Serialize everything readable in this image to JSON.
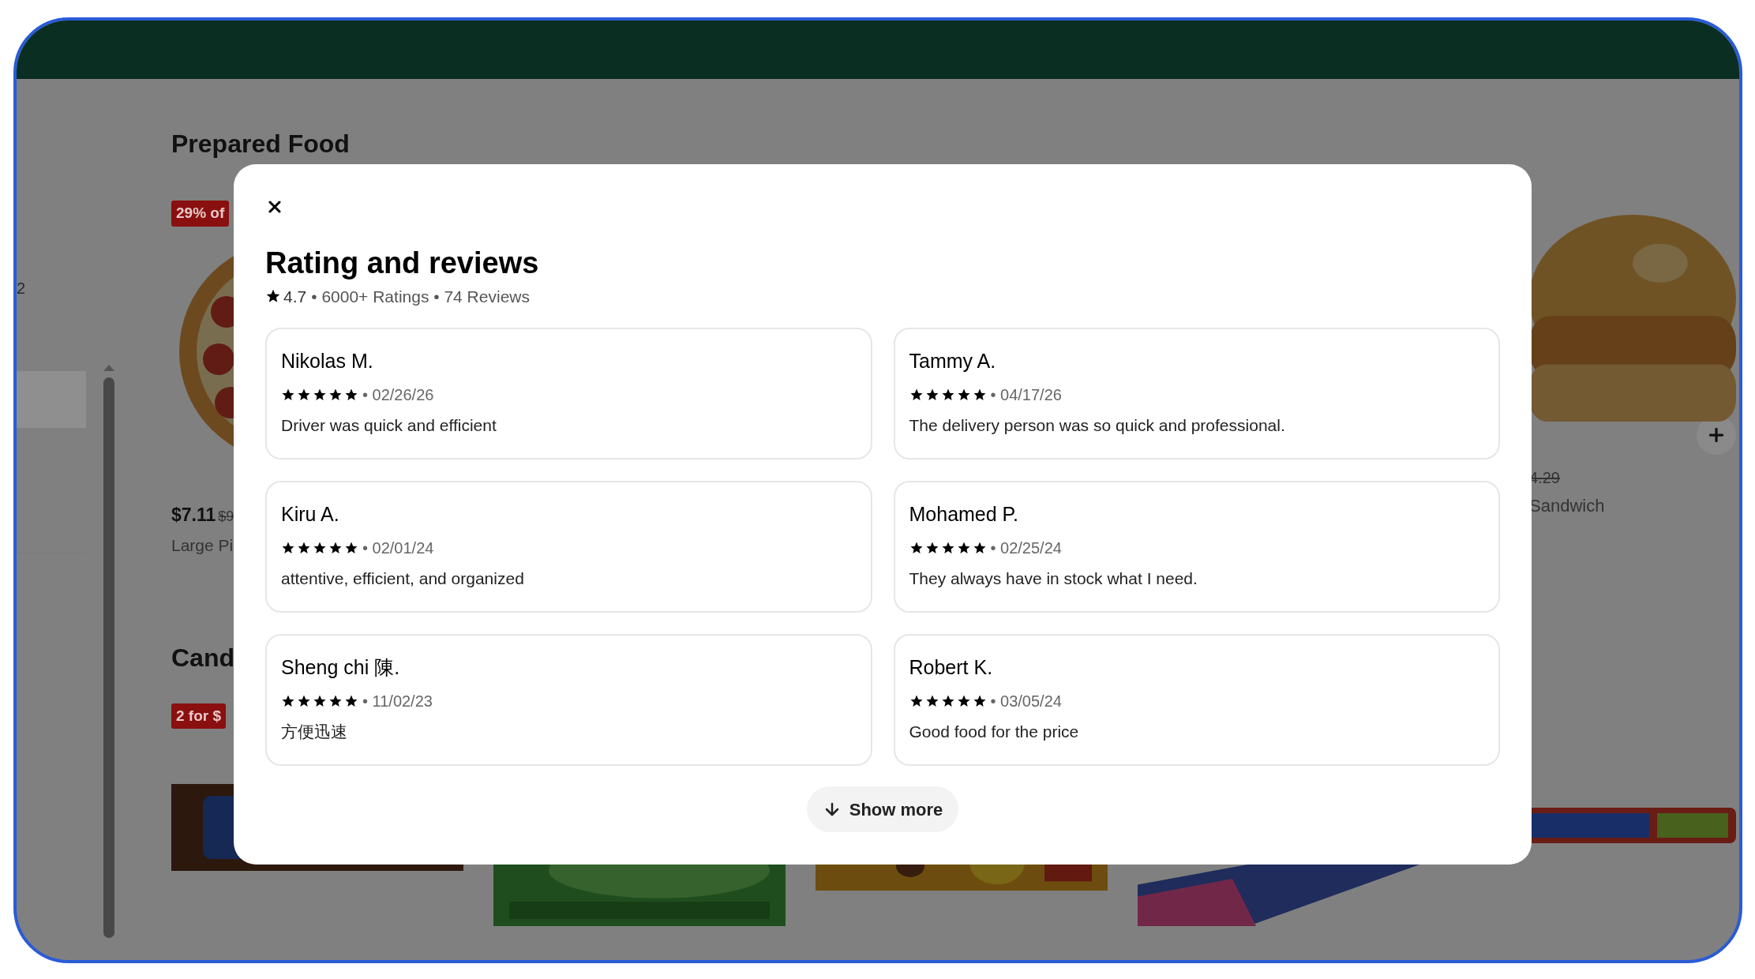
{
  "sidebar": {
    "items": [
      {
        "label": "2",
        "selected": false
      },
      {
        "selected": true
      }
    ]
  },
  "sections": [
    {
      "title": "Prepared Food",
      "left": {
        "badge": "29% of",
        "price": "$7.11",
        "old_price": "$9",
        "name": "Large Pi"
      },
      "right": {
        "old_price": "4.29",
        "name": "Sandwich"
      }
    },
    {
      "title": "Cand",
      "left": {
        "badge": "2 for $"
      }
    }
  ],
  "modal": {
    "title": "Rating and reviews",
    "summary": {
      "rating": "4.7",
      "details": "• 6000+ Ratings • 74 Reviews"
    },
    "reviews": [
      {
        "name": "Nikolas M.",
        "stars": 5,
        "date": "• 02/26/26",
        "text": "Driver was quick and efficient"
      },
      {
        "name": "Tammy A.",
        "stars": 5,
        "date": "• 04/17/26",
        "text": "The delivery person was so quick and professional."
      },
      {
        "name": "Kiru A.",
        "stars": 5,
        "date": "• 02/01/24",
        "text": "attentive, efficient, and organized"
      },
      {
        "name": "Mohamed P.",
        "stars": 5,
        "date": "• 02/25/24",
        "text": "They always have in stock what I need."
      },
      {
        "name": "Sheng chi 陳.",
        "stars": 5,
        "date": "• 11/02/23",
        "text": "方便迅速"
      },
      {
        "name": "Robert K.",
        "stars": 5,
        "date": "• 03/05/24",
        "text": "Good food for the price"
      }
    ],
    "show_more": "Show more"
  }
}
